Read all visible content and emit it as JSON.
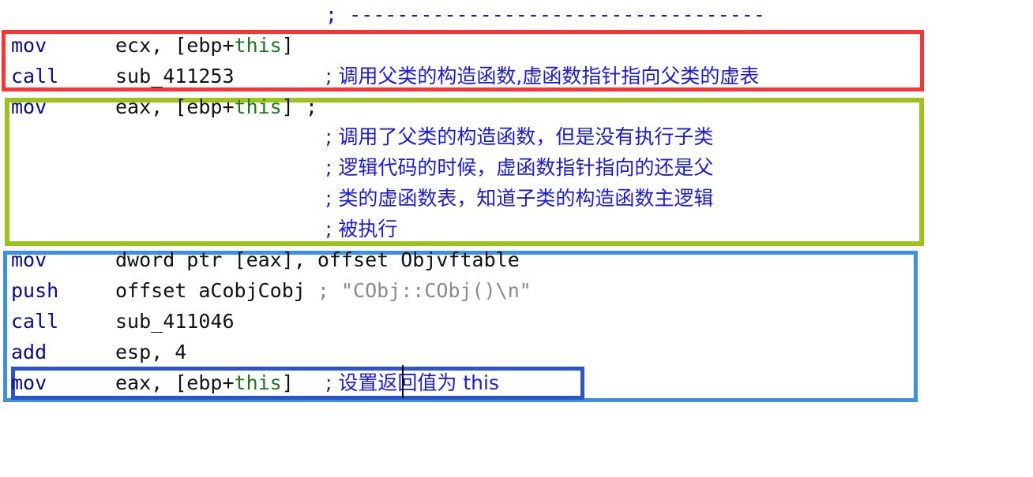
{
  "colors": {
    "red_box": "#ff3333",
    "green_box": "#9bc41a",
    "blue_box": "#3d8fe0",
    "dark_blue_box": "#2f54c8",
    "comment": "#1b1bd6",
    "string": "#8a8a8a",
    "keyword": "#1a7a1a"
  },
  "separator": "; -----------------------------------",
  "red_block": {
    "line1": {
      "mnemonic": "mov",
      "op_prefix": "ecx, [ebp+",
      "op_kw": "this",
      "op_suffix": "]"
    },
    "line2": {
      "mnemonic": "call",
      "operand": "sub_411253",
      "comment": "; 调用父类的构造函数,虚函数指针指向父类的虚表"
    }
  },
  "green_block": {
    "line1": {
      "mnemonic": "mov",
      "op_prefix": "eax, [ebp+",
      "op_kw": "this",
      "op_suffix": "] ;"
    },
    "comments": [
      "; 调用了父类的构造函数，但是没有执行子类",
      "; 逻辑代码的时候，虚函数指针指向的还是父",
      "; 类的虚函数表，知道子类的构造函数主逻辑",
      "; 被执行"
    ]
  },
  "blue_block": {
    "line1": {
      "mnemonic": "mov",
      "operand": "dword ptr [eax], offset Objvftable"
    },
    "line2": {
      "mnemonic": "push",
      "operand": "offset aCobjCobj",
      "comment": "; \"CObj::CObj()\\n\""
    },
    "line3": {
      "mnemonic": "call",
      "operand": "sub_411046"
    },
    "line4": {
      "mnemonic": "add",
      "operand": "esp, 4"
    },
    "line5": {
      "mnemonic": "mov",
      "op_prefix": "eax, [ebp+",
      "op_kw": "this",
      "op_suffix": "]",
      "comment_pre": "; 设置",
      "comment_post": "返回值为 this"
    }
  }
}
